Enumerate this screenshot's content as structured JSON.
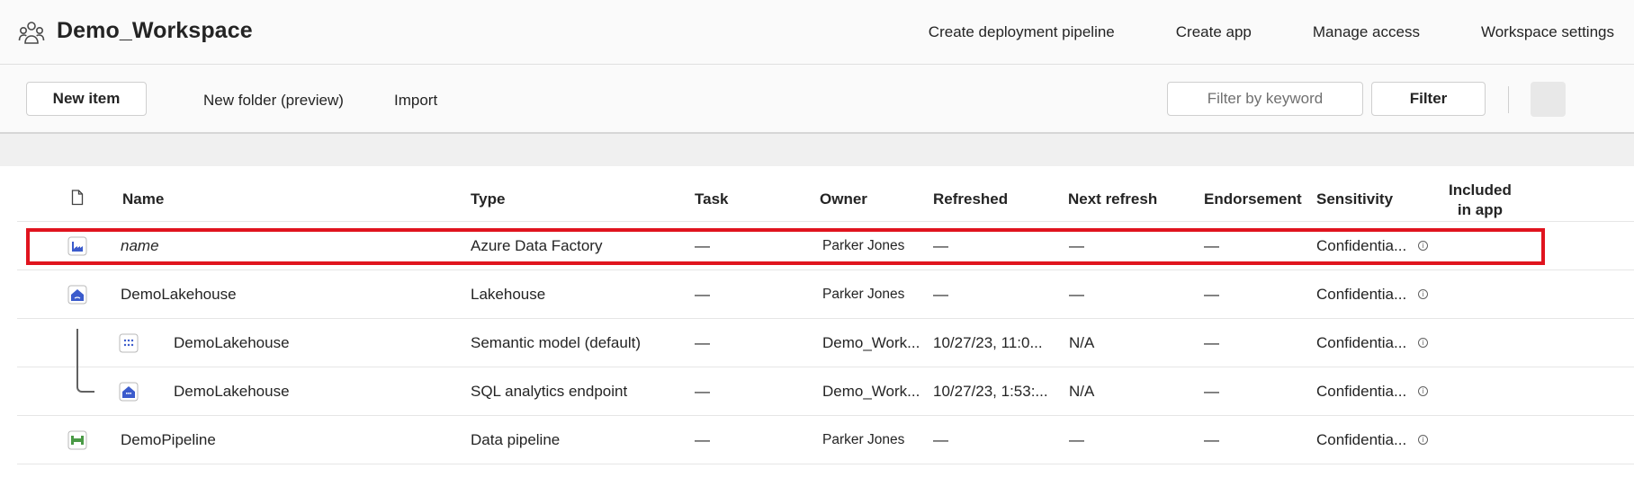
{
  "header": {
    "workspace_title": "Demo_Workspace",
    "workspace_icon": "workspace-people-icon",
    "actions": [
      "Create deployment pipeline",
      "Create app",
      "Manage access",
      "Workspace settings"
    ]
  },
  "toolbar": {
    "new_item": "New item",
    "new_folder": "New folder (preview)",
    "import": "Import",
    "filter_placeholder": "Filter by keyword",
    "filter_value": "",
    "filter_button": "Filter"
  },
  "table": {
    "columns": {
      "name": "Name",
      "type": "Type",
      "task": "Task",
      "owner": "Owner",
      "refreshed": "Refreshed",
      "next_refresh": "Next refresh",
      "endorsement": "Endorsement",
      "sensitivity": "Sensitivity",
      "included_line1": "Included",
      "included_line2": "in app"
    },
    "rows": [
      {
        "name": "name",
        "type": "Azure Data Factory",
        "task": "—",
        "owner": "Parker Jones",
        "refreshed": "—",
        "next_refresh": "—",
        "endorsement": "—",
        "sensitivity": "Confidentia...",
        "icon": "data-factory-icon"
      },
      {
        "name": "DemoLakehouse",
        "type": "Lakehouse",
        "task": "—",
        "owner": "Parker Jones",
        "refreshed": "—",
        "next_refresh": "—",
        "endorsement": "—",
        "sensitivity": "Confidentia...",
        "icon": "lakehouse-icon"
      },
      {
        "name": "DemoLakehouse",
        "type": "Semantic model (default)",
        "task": "—",
        "owner": "Demo_Work...",
        "refreshed": "10/27/23, 11:0...",
        "next_refresh": "N/A",
        "endorsement": "—",
        "sensitivity": "Confidentia...",
        "icon": "semantic-model-icon"
      },
      {
        "name": "DemoLakehouse",
        "type": "SQL analytics endpoint",
        "task": "—",
        "owner": "Demo_Work...",
        "refreshed": "10/27/23, 1:53:...",
        "next_refresh": "N/A",
        "endorsement": "—",
        "sensitivity": "Confidentia...",
        "icon": "sql-endpoint-icon"
      },
      {
        "name": "DemoPipeline",
        "type": "Data pipeline",
        "task": "—",
        "owner": "Parker Jones",
        "refreshed": "—",
        "next_refresh": "—",
        "endorsement": "—",
        "sensitivity": "Confidentia...",
        "icon": "pipeline-icon"
      }
    ]
  },
  "colors": {
    "highlight": "#e0141e",
    "accent_blue": "#3b5bcc",
    "pipeline_green": "#4a9a46"
  }
}
